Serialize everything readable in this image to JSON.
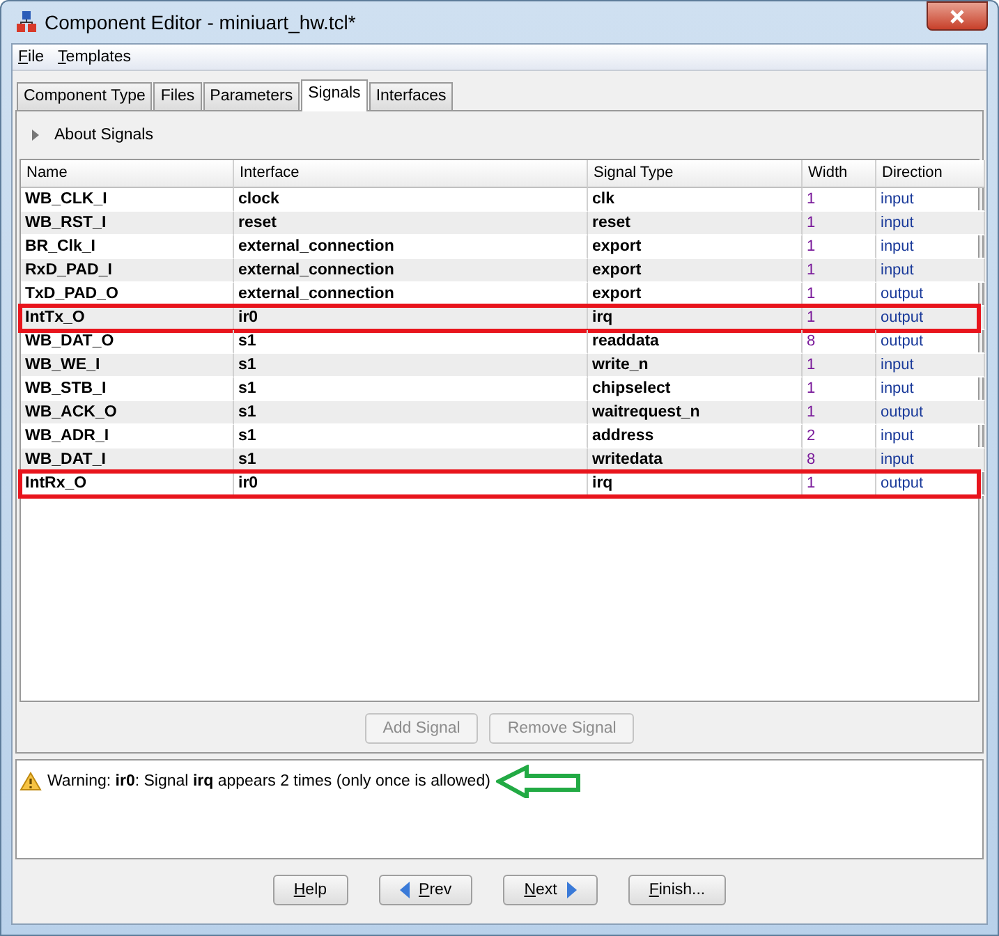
{
  "window": {
    "title": "Component Editor - miniuart_hw.tcl*"
  },
  "menu": [
    "File",
    "Templates"
  ],
  "tabs": [
    {
      "label": "Component Type",
      "selected": false
    },
    {
      "label": "Files",
      "selected": false
    },
    {
      "label": "Parameters",
      "selected": false
    },
    {
      "label": "Signals",
      "selected": true
    },
    {
      "label": "Interfaces",
      "selected": false
    }
  ],
  "about": {
    "label": "About Signals",
    "expanded": false
  },
  "table": {
    "columns": [
      "Name",
      "Interface",
      "Signal Type",
      "Width",
      "Direction"
    ],
    "rows": [
      {
        "cells": [
          "WB_CLK_I",
          "clock",
          "clk",
          "1",
          "input"
        ],
        "highlighted": false
      },
      {
        "cells": [
          "WB_RST_I",
          "reset",
          "reset",
          "1",
          "input"
        ],
        "highlighted": false
      },
      {
        "cells": [
          "BR_Clk_I",
          "external_connection",
          "export",
          "1",
          "input"
        ],
        "highlighted": false
      },
      {
        "cells": [
          "RxD_PAD_I",
          "external_connection",
          "export",
          "1",
          "input"
        ],
        "highlighted": false
      },
      {
        "cells": [
          "TxD_PAD_O",
          "external_connection",
          "export",
          "1",
          "output"
        ],
        "highlighted": false
      },
      {
        "cells": [
          "IntTx_O",
          "ir0",
          "irq",
          "1",
          "output"
        ],
        "highlighted": true
      },
      {
        "cells": [
          "WB_DAT_O",
          "s1",
          "readdata",
          "8",
          "output"
        ],
        "highlighted": false
      },
      {
        "cells": [
          "WB_WE_I",
          "s1",
          "write_n",
          "1",
          "input"
        ],
        "highlighted": false
      },
      {
        "cells": [
          "WB_STB_I",
          "s1",
          "chipselect",
          "1",
          "input"
        ],
        "highlighted": false
      },
      {
        "cells": [
          "WB_ACK_O",
          "s1",
          "waitrequest_n",
          "1",
          "output"
        ],
        "highlighted": false
      },
      {
        "cells": [
          "WB_ADR_I",
          "s1",
          "address",
          "2",
          "input"
        ],
        "highlighted": false
      },
      {
        "cells": [
          "WB_DAT_I",
          "s1",
          "writedata",
          "8",
          "input"
        ],
        "highlighted": false
      },
      {
        "cells": [
          "IntRx_O",
          "ir0",
          "irq",
          "1",
          "output"
        ],
        "highlighted": true
      }
    ]
  },
  "signal_buttons": [
    {
      "label": "Add Signal",
      "disabled": true
    },
    {
      "label": "Remove Signal",
      "disabled": true
    }
  ],
  "messages": [
    {
      "text": "Warning: **ir0**: Signal **irq** appears 2 times (only once is allowed)",
      "kind": "warning",
      "pointed_at": true
    }
  ],
  "buttons": [
    {
      "label": "Help",
      "kind": "plain"
    },
    {
      "label": "Prev",
      "kind": "back"
    },
    {
      "label": "Next",
      "kind": "forward"
    },
    {
      "label": "Finish...",
      "kind": "plain"
    }
  ]
}
